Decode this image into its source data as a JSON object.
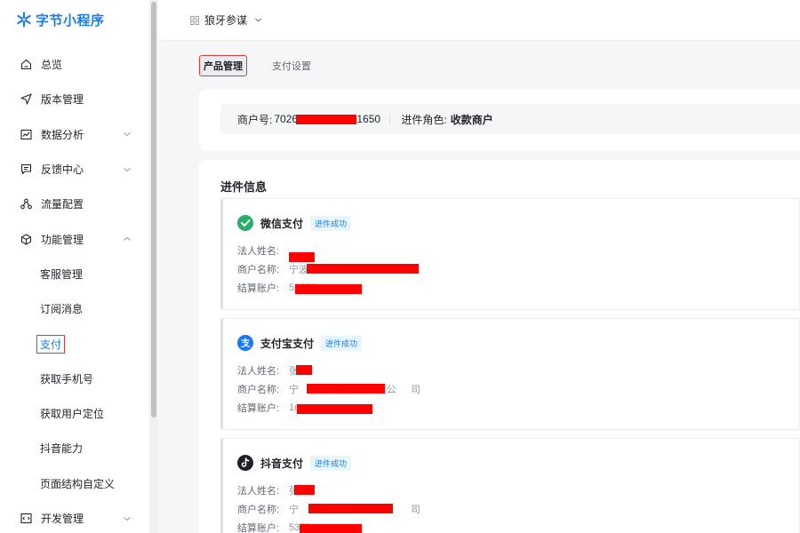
{
  "app": {
    "name": "字节小程序",
    "brand_color": "#1b7ce8"
  },
  "sidebar": {
    "items": [
      {
        "label": "总览",
        "icon": "home-icon"
      },
      {
        "label": "版本管理",
        "icon": "send-icon"
      },
      {
        "label": "数据分析",
        "icon": "chart-icon",
        "expandable": true
      },
      {
        "label": "反馈中心",
        "icon": "message-icon",
        "expandable": true
      },
      {
        "label": "流量配置",
        "icon": "share-icon"
      },
      {
        "label": "功能管理",
        "icon": "cube-icon",
        "expanded": true
      }
    ],
    "sub_items": [
      {
        "label": "客服管理"
      },
      {
        "label": "订阅消息"
      },
      {
        "label": "支付",
        "active": true
      },
      {
        "label": "获取手机号"
      },
      {
        "label": "获取用户定位"
      },
      {
        "label": "抖音能力"
      },
      {
        "label": "页面结构自定义"
      }
    ],
    "bottom_item": {
      "label": "开发管理",
      "icon": "code-icon"
    }
  },
  "topbar": {
    "project_name": "狼牙参谋"
  },
  "tabs": [
    {
      "label": "产品管理",
      "active": true
    },
    {
      "label": "支付设置",
      "active": false
    }
  ],
  "merchant": {
    "id_label": "商户号:",
    "id_prefix": "7026",
    "id_suffix": "1650",
    "role_label": "进件角色:",
    "role_value": "收款商户"
  },
  "info": {
    "title": "进件信息",
    "field_labels": {
      "legal_name": "法人姓名:",
      "merchant_name": "商户名称:",
      "account": "结算账户:"
    },
    "payments": [
      {
        "name": "微信支付",
        "icon": "wechat-pay-icon",
        "status": "进件成功",
        "legal_name": "",
        "merchant_name": "宁波",
        "account": "52575"
      },
      {
        "name": "支付宝支付",
        "icon": "alipay-icon",
        "status": "进件成功",
        "legal_name": "张",
        "merchant_name": "宁波有限公司",
        "account": "1com"
      },
      {
        "name": "抖音支付",
        "icon": "douyin-pay-icon",
        "status": "进件成功",
        "legal_name": "张",
        "merchant_name": "宁波限公司",
        "account": "5375"
      }
    ]
  },
  "colors": {
    "wechat": "#2aae67",
    "alipay": "#1677ff",
    "douyin": "#1f2329",
    "redaction": "#ff0000",
    "highlight_box": "#e53935"
  }
}
